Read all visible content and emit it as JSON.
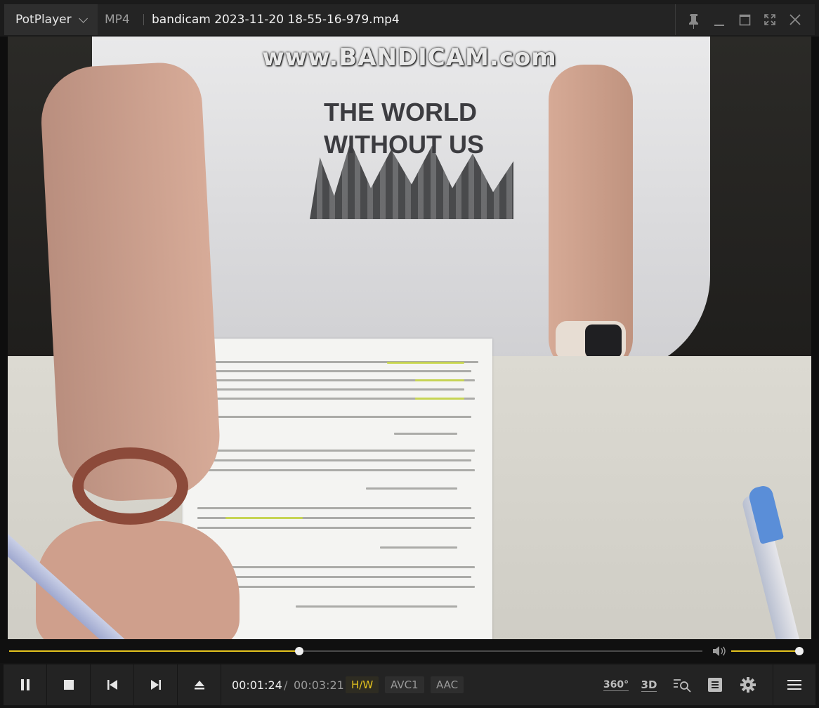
{
  "app": {
    "name": "PotPlayer",
    "format": "MP4",
    "file_title": "bandicam 2023-11-20 18-55-16-979.mp4"
  },
  "video": {
    "watermark": "www.BANDICAM.com",
    "shirt_text_line1": "THE WORLD",
    "shirt_text_line2": "WITHOUT US"
  },
  "playback": {
    "current_time": "00:01:24",
    "separator": "/",
    "total_time": "00:03:21",
    "progress_fraction": 0.418,
    "volume_fraction": 1.0
  },
  "badges": {
    "hw": "H/W",
    "video_codec": "AVC1",
    "audio_codec": "AAC"
  },
  "right_controls": {
    "vr_label": "360°",
    "threed_label": "3D"
  },
  "colors": {
    "accent": "#e3c21e",
    "titlebar": "#242424",
    "controlbar": "#232323"
  },
  "icons": [
    "chevron-down-icon",
    "pin-icon",
    "minimize-icon",
    "maximize-icon",
    "fullscreen-icon",
    "close-icon",
    "pause-icon",
    "stop-icon",
    "previous-icon",
    "next-icon",
    "eject-icon",
    "volume-icon",
    "360-icon",
    "3d-icon",
    "search-zoom-icon",
    "playlist-icon",
    "settings-icon",
    "menu-icon"
  ]
}
